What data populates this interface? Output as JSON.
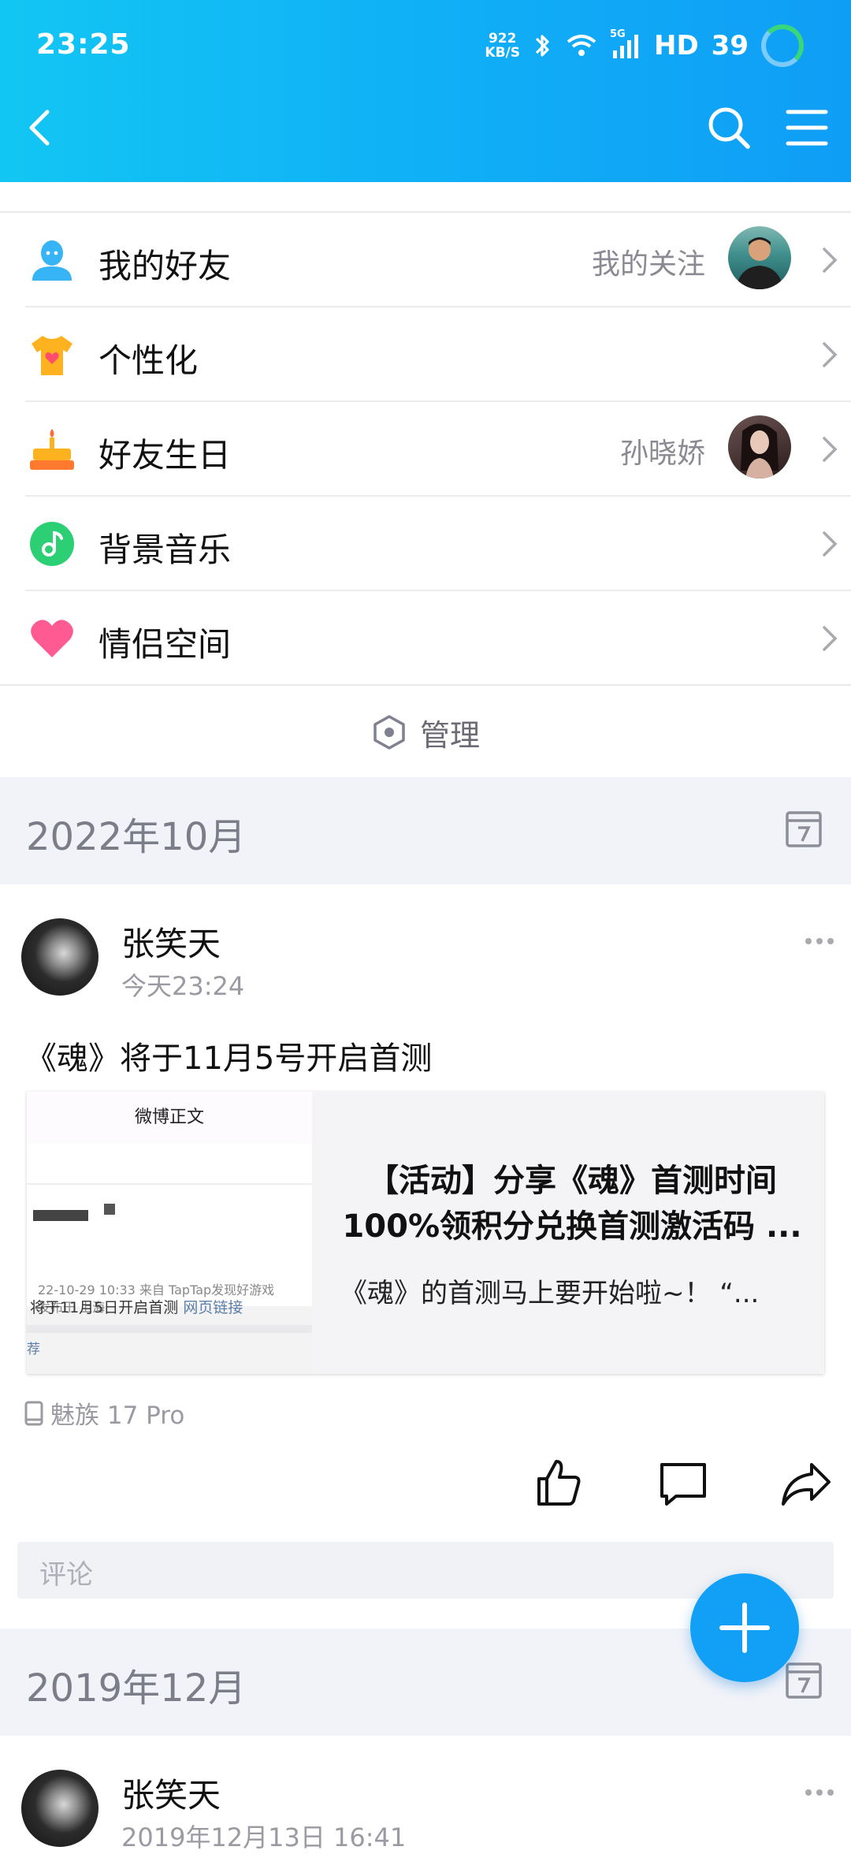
{
  "status_bar": {
    "time": "23:25",
    "net_speed_value": "922",
    "net_speed_unit": "KB/S",
    "network": "5G",
    "hd": "HD",
    "battery": "39"
  },
  "header": {
    "back_icon": "chevron-left-icon",
    "search_icon": "search-icon",
    "menu_icon": "hamburger-menu-icon"
  },
  "menu_items": [
    {
      "label": "我的好友",
      "sub": "我的关注",
      "icon": "friend-icon",
      "has_avatar": true
    },
    {
      "label": "个性化",
      "sub": "",
      "icon": "tshirt-icon",
      "has_avatar": false
    },
    {
      "label": "好友生日",
      "sub": "孙晓娇",
      "icon": "birthday-cake-icon",
      "has_avatar": true
    },
    {
      "label": "背景音乐",
      "sub": "",
      "icon": "music-note-icon",
      "has_avatar": false
    },
    {
      "label": "情侣空间",
      "sub": "",
      "icon": "heart-icon",
      "has_avatar": false
    }
  ],
  "manage": {
    "label": "管理",
    "icon": "hexagon-settings-icon"
  },
  "sections": [
    {
      "month": "2022年10月"
    },
    {
      "month": "2019年12月"
    }
  ],
  "posts": [
    {
      "author": "张笑天",
      "time": "今天23:24",
      "text": "《魂》将于11月5号开启首测",
      "share": {
        "thumb_header": "微博正文",
        "thumb_meta1": "22-10-29 10:33  来自 TapTap发现好游戏",
        "thumb_meta2": "发布于 上海",
        "thumb_text": "将于11月5日开启首测",
        "thumb_link": "网页链接",
        "thumb_rec": "荐",
        "title": "【活动】分享《魂》首测时间100%领积分兑换首测激活码 ...",
        "title_line1": "【活动】分享《魂》首测时间",
        "title_line2": "100%领积分兑换首测激活码 ...",
        "desc": "《魂》的首测马上要开始啦~！ “..."
      },
      "device": "魅族 17 Pro"
    },
    {
      "author": "张笑天",
      "time": "2019年12月13日 16:41"
    }
  ],
  "comment": {
    "placeholder": "评论"
  },
  "actions": [
    "like-icon",
    "comment-icon",
    "share-icon"
  ],
  "fab": {
    "icon": "plus-icon"
  },
  "colors": {
    "accent": "#12a0f6",
    "header_start": "#12c6f3",
    "header_end": "#0f9ef6"
  }
}
